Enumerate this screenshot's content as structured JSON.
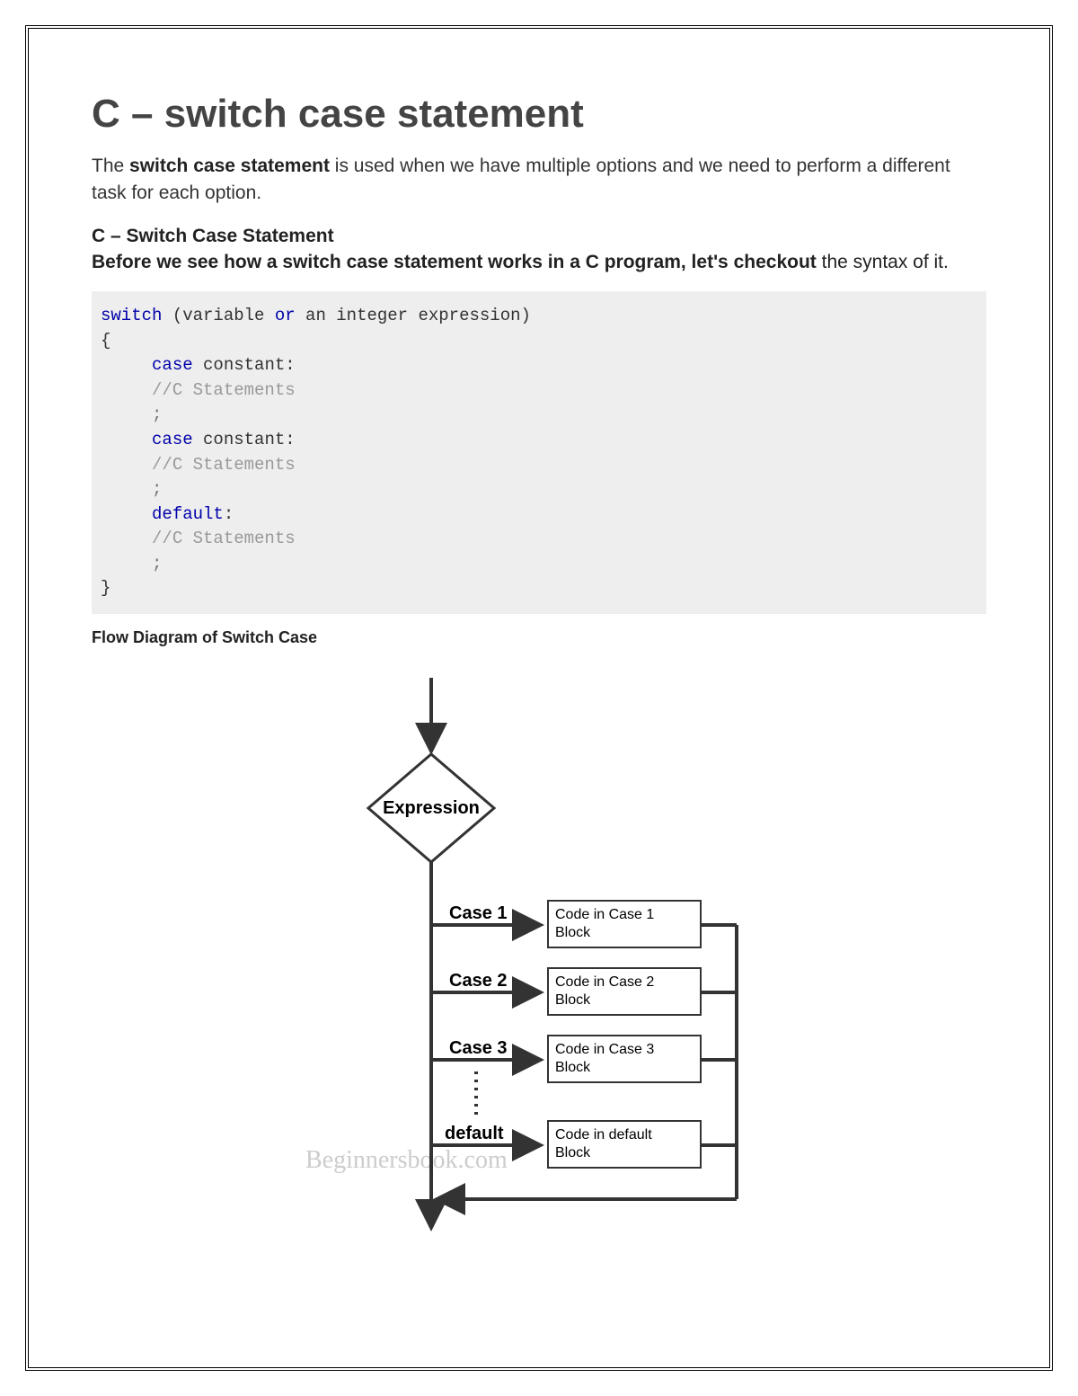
{
  "title": "C – switch case statement",
  "intro_prefix": "The ",
  "intro_bold": "switch case statement",
  "intro_suffix": " is used when we have multiple options and we need to perform a different task for each option.",
  "subtitle": "C – Switch Case Statement",
  "lead_bold": "Before we see how a switch case statement works in a C program, let's checkout",
  "lead_rest": " the syntax of it.",
  "code": {
    "kw_switch": "switch",
    "paren_open": " (variable ",
    "kw_or": "or",
    "paren_rest": " an integer expression)",
    "brace_open": "{",
    "indent": "     ",
    "kw_case": "case",
    "case_rest": " constant:",
    "comment": "//C Statements",
    "semicolon": ";",
    "kw_default": "default",
    "default_rest": ":",
    "brace_close": "}"
  },
  "flow_title": "Flow Diagram of Switch Case",
  "diagram": {
    "expression": "Expression",
    "cases": [
      "Case 1",
      "Case 2",
      "Case 3",
      "default"
    ],
    "blocks": [
      "Code in Case 1 Block",
      "Code in Case 2 Block",
      "Code in Case 3 Block",
      "Code in default Block"
    ],
    "watermark": "Beginnersbook.com"
  }
}
